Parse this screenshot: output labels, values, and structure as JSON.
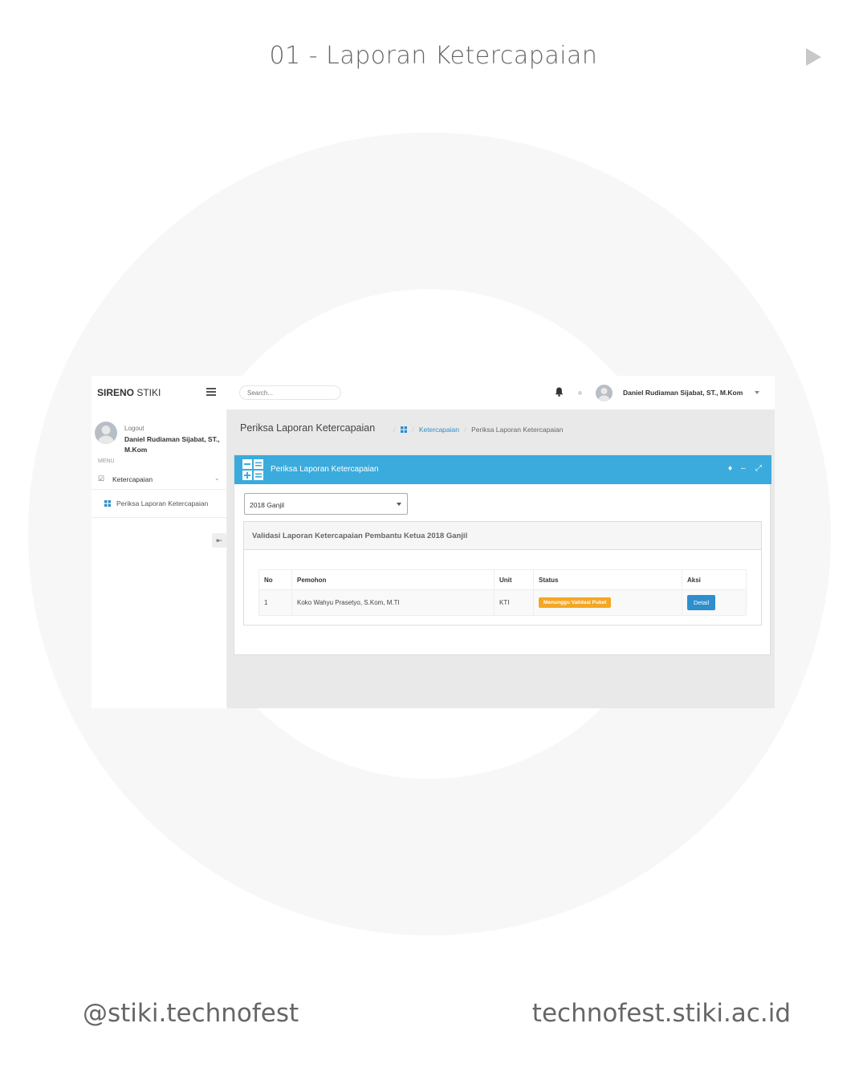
{
  "slide": {
    "title": "01 - Laporan Ketercapaian",
    "footer_handle": "@stiki.technofest",
    "footer_url": "technofest.stiki.ac.id"
  },
  "app": {
    "brand_bold": "SIRENO",
    "brand_light": " STIKI",
    "search_placeholder": "Search...",
    "user_name": "Daniel Rudiaman Sijabat, ST., M.Kom",
    "sidebar": {
      "logout": "Logout",
      "user_name": "Daniel Rudiaman Sijabat, ST., M.Kom",
      "menu_label": "MENU",
      "menu_item": "Ketercapaian",
      "submenu_item": "Periksa Laporan Ketercapaian"
    },
    "page_title": "Periksa Laporan Ketercapaian",
    "breadcrumb": {
      "link": "Ketercapaian",
      "current": "Periksa Laporan Ketercapaian"
    },
    "panel": {
      "title": "Periksa Laporan Ketercapaian",
      "semester_selected": "2018 Ganjil",
      "box_title": "Validasi Laporan Ketercapaian Pembantu Ketua 2018 Ganjil"
    },
    "table": {
      "headers": {
        "no": "No",
        "pemohon": "Pemohon",
        "unit": "Unit",
        "status": "Status",
        "aksi": "Aksi"
      },
      "rows": [
        {
          "no": "1",
          "pemohon": "Koko Wahyu Prasetyo, S.Kom, M.TI",
          "unit": "KTI",
          "status": "Menunggu Validasi Puket",
          "action": "Detail"
        }
      ]
    },
    "colors": {
      "accent": "#3aabdc",
      "link": "#2e8ece",
      "warning": "#f5a623"
    }
  }
}
